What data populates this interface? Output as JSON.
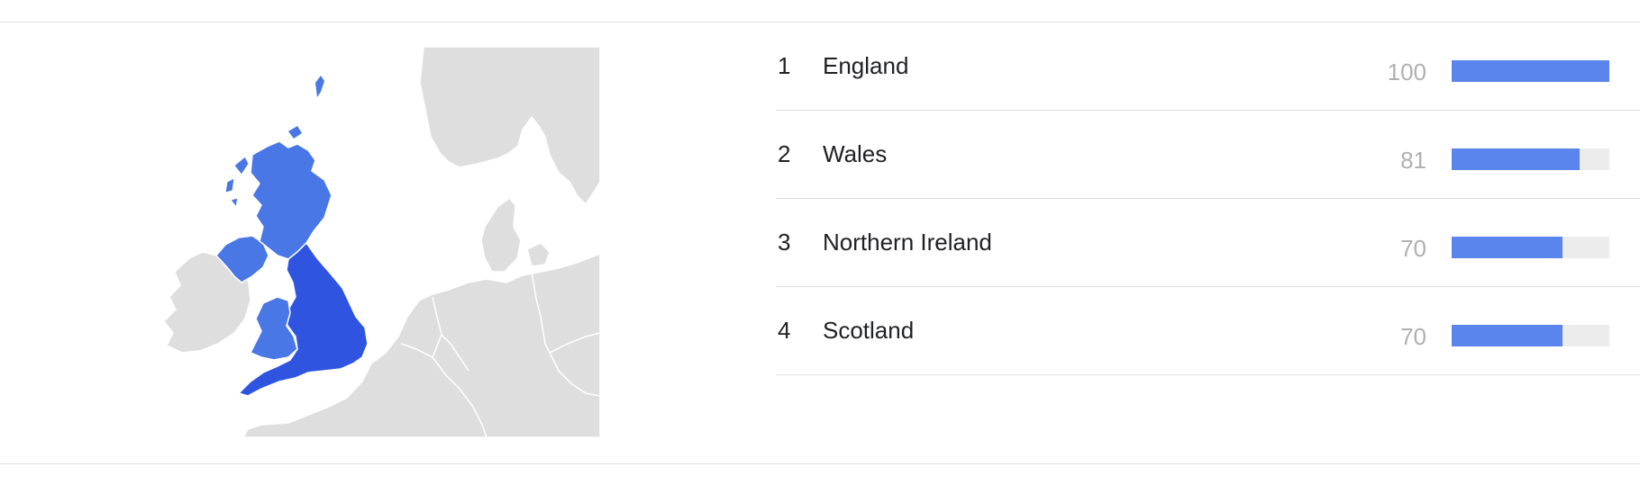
{
  "map": {
    "region_colors": {
      "highest": "#2f55e0",
      "mid": "#4a77e6",
      "other_land": "#dedede",
      "border": "#ffffff"
    },
    "regions": [
      {
        "name": "England",
        "value": 100
      },
      {
        "name": "Wales",
        "value": 81
      },
      {
        "name": "Northern Ireland",
        "value": 70
      },
      {
        "name": "Scotland",
        "value": 70
      }
    ]
  },
  "list": {
    "rows": [
      {
        "rank": "1",
        "name": "England",
        "value": "100",
        "score": 100
      },
      {
        "rank": "2",
        "name": "Wales",
        "value": "81",
        "score": 81
      },
      {
        "rank": "3",
        "name": "Northern Ireland",
        "value": "70",
        "score": 70
      },
      {
        "rank": "4",
        "name": "Scotland",
        "value": "70",
        "score": 70
      }
    ]
  },
  "colors": {
    "bar_fill": "#5a85ec",
    "bar_track": "#ececec",
    "rank_text": "#202124",
    "value_text": "#b0b0b0",
    "divider": "#e0e0e0"
  },
  "chart_data": {
    "type": "bar",
    "title": "",
    "xlabel": "",
    "ylabel": "",
    "orientation": "horizontal",
    "categories": [
      "England",
      "Wales",
      "Northern Ireland",
      "Scotland"
    ],
    "values": [
      100,
      81,
      70,
      70
    ],
    "xlim": [
      0,
      100
    ],
    "grid": false,
    "legend": "none",
    "companion": "choropleth map of the United Kingdom shaded by the same values"
  }
}
